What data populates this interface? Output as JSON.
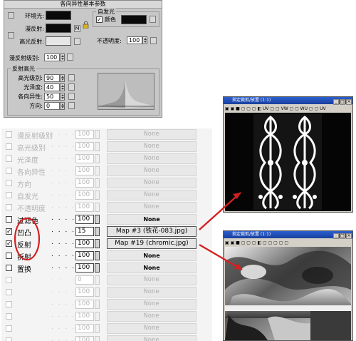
{
  "params_panel": {
    "title": "各向异性基本参数",
    "ambient_label": "环境光:",
    "diffuse_label": "漫反射:",
    "specular_label": "高光反射:",
    "map_btn_label": "M",
    "self_illum": {
      "group_title": "自发光",
      "color_label": "颜色",
      "checked_mark": "✓"
    },
    "opacity": {
      "label": "不透明度:",
      "value": "100"
    },
    "diffuse_level": {
      "label": "漫反射级别:",
      "value": "100"
    },
    "specular_group": {
      "title": "反射高光",
      "rows": [
        {
          "label": "高光级别:",
          "value": "90"
        },
        {
          "label": "光泽度:",
          "value": "40"
        },
        {
          "label": "各向异性:",
          "value": "50"
        },
        {
          "label": "方向:",
          "value": "0"
        }
      ]
    },
    "colors": {
      "ambient": "#0a0a0a",
      "diffuse": "#0a0a0a",
      "specular": "#e6e6e6",
      "self_illum": "#0a0a0a",
      "panel_bg": "#c8c8c8"
    }
  },
  "maps": {
    "rows": [
      {
        "name": "漫反射级别",
        "amount": "100",
        "map": "None",
        "enabled": false,
        "checked": false,
        "active": false
      },
      {
        "name": "高光级别",
        "amount": "100",
        "map": "None",
        "enabled": false,
        "checked": false,
        "active": false
      },
      {
        "name": "光泽度",
        "amount": "100",
        "map": "None",
        "enabled": false,
        "checked": false,
        "active": false
      },
      {
        "name": "各向异性",
        "amount": "100",
        "map": "None",
        "enabled": false,
        "checked": false,
        "active": false
      },
      {
        "name": "方向",
        "amount": "100",
        "map": "None",
        "enabled": false,
        "checked": false,
        "active": false
      },
      {
        "name": "自发光",
        "amount": "100",
        "map": "None",
        "enabled": false,
        "checked": false,
        "active": false
      },
      {
        "name": "不透明度",
        "amount": "100",
        "map": "None",
        "enabled": false,
        "checked": false,
        "active": false
      },
      {
        "name": "过滤色",
        "amount": "100",
        "map": "None",
        "enabled": true,
        "checked": false,
        "active": false
      },
      {
        "name": "凹凸",
        "amount": "15",
        "map": "Map #3 (铁花-083.jpg)",
        "enabled": true,
        "checked": true,
        "active": true
      },
      {
        "name": "反射",
        "amount": "100",
        "map": "Map #19 (chromic.jpg)",
        "enabled": true,
        "checked": true,
        "active": true
      },
      {
        "name": "折射",
        "amount": "100",
        "map": "None",
        "enabled": true,
        "checked": false,
        "active": false
      },
      {
        "name": "置换",
        "amount": "100",
        "map": "None",
        "enabled": true,
        "checked": false,
        "active": false
      },
      {
        "name": "",
        "amount": "0",
        "map": "None",
        "enabled": false,
        "checked": false,
        "active": false
      },
      {
        "name": "",
        "amount": "100",
        "map": "None",
        "enabled": false,
        "checked": false,
        "active": false
      },
      {
        "name": "",
        "amount": "100",
        "map": "None",
        "enabled": false,
        "checked": false,
        "active": false
      },
      {
        "name": "",
        "amount": "100",
        "map": "None",
        "enabled": false,
        "checked": false,
        "active": false
      },
      {
        "name": "",
        "amount": "100",
        "map": "None",
        "enabled": false,
        "checked": false,
        "active": false
      },
      {
        "name": "",
        "amount": "100",
        "map": "None",
        "enabled": false,
        "checked": false,
        "active": false
      }
    ],
    "dots": ". . . ."
  },
  "viewer_top": {
    "title": "指定裁剪/放置 (1:1)",
    "toolbar": "▣ ▣ ■ ▢ ▢ ▢ ◧ UV ▢ ▢ VW ▢ ▢ WU ▢ ▢ UV",
    "buttons": [
      "_",
      "□",
      "×"
    ]
  },
  "viewer_bottom": {
    "title": "指定裁剪/放置 (1:1)",
    "toolbar": "▣ ▣ ■ ▢ ▢ ▢ ◧ ▢ ▢ ▢ ▢ ▢",
    "buttons": [
      "_",
      "□",
      "×"
    ]
  },
  "annotation": {
    "circle_color": "#d42020",
    "arrow_color": "#d42020"
  }
}
